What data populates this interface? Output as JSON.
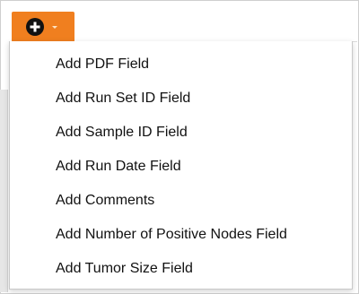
{
  "toolbar": {
    "add_button_icon": "plus-circle-icon",
    "dropdown_icon": "caret-down-icon",
    "accent_color": "#f07f1f"
  },
  "menu": {
    "items": [
      {
        "label": "Add PDF Field"
      },
      {
        "label": "Add Run Set ID Field"
      },
      {
        "label": "Add Sample ID Field"
      },
      {
        "label": "Add Run Date Field"
      },
      {
        "label": "Add Comments"
      },
      {
        "label": "Add Number of Positive Nodes Field"
      },
      {
        "label": "Add Tumor Size Field"
      }
    ]
  }
}
